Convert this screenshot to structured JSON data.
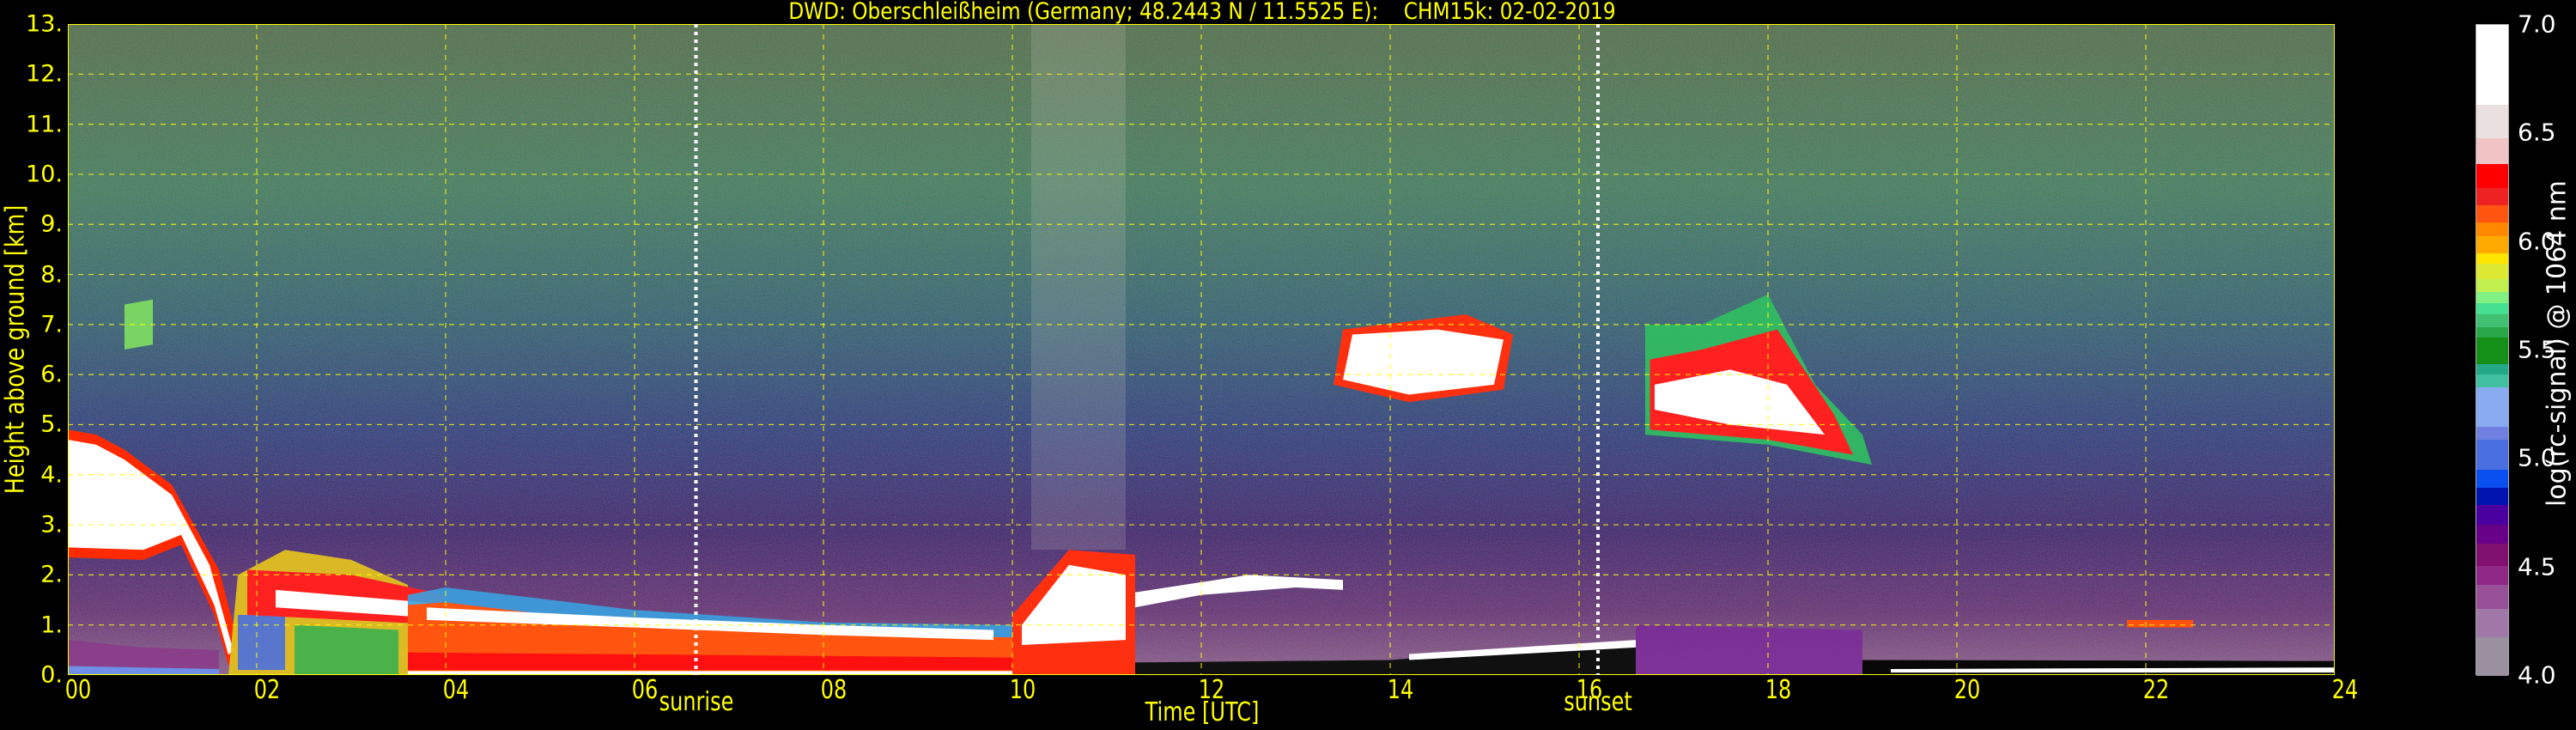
{
  "chart_data": {
    "type": "heatmap",
    "title": "DWD: Oberschleißheim (Germany; 48.2443 N / 11.5525 E):    CHM15k: 02-02-2019",
    "xlabel": "Time [UTC]",
    "ylabel": "Height above ground [km]",
    "xlim": [
      0,
      24
    ],
    "ylim": [
      0,
      13
    ],
    "grid": true,
    "x_ticks": [
      0,
      2,
      4,
      6,
      8,
      10,
      12,
      14,
      16,
      18,
      20,
      22,
      24
    ],
    "x_tick_labels": [
      "00",
      "02",
      "04",
      "06",
      "08",
      "10",
      "12",
      "14",
      "16",
      "18",
      "20",
      "22",
      "24"
    ],
    "y_ticks": [
      0,
      1,
      2,
      3,
      4,
      5,
      6,
      7,
      8,
      9,
      10,
      11,
      12,
      13
    ],
    "y_tick_labels": [
      "0.",
      "1.",
      "2.",
      "3.",
      "4.",
      "5.",
      "6.",
      "7.",
      "8.",
      "9.",
      "10.",
      "11.",
      "12.",
      "13."
    ],
    "markers": [
      {
        "label": "sunrise",
        "x": 6.65
      },
      {
        "label": "sunset",
        "x": 16.2
      }
    ],
    "colorbar": {
      "label": "log(rc-signal) @ 1064 nm",
      "range": [
        4.0,
        7.0
      ],
      "tick_values": [
        4.0,
        4.5,
        5.0,
        5.5,
        6.0,
        6.5,
        7.0
      ],
      "tick_labels": [
        "4.0",
        "4.5",
        "5.0",
        "5.5",
        "6.0",
        "6.5",
        "7.0"
      ],
      "levels": [
        {
          "from": 4.0,
          "to": 4.18,
          "color": "#9a90a0"
        },
        {
          "from": 4.18,
          "to": 4.31,
          "color": "#a078a8"
        },
        {
          "from": 4.31,
          "to": 4.42,
          "color": "#985098"
        },
        {
          "from": 4.42,
          "to": 4.51,
          "color": "#902888"
        },
        {
          "from": 4.51,
          "to": 4.61,
          "color": "#801070"
        },
        {
          "from": 4.61,
          "to": 4.7,
          "color": "#680088"
        },
        {
          "from": 4.7,
          "to": 4.79,
          "color": "#4a00a0"
        },
        {
          "from": 4.79,
          "to": 4.87,
          "color": "#0014b0"
        },
        {
          "from": 4.87,
          "to": 4.95,
          "color": "#0a50f0"
        },
        {
          "from": 4.95,
          "to": 5.09,
          "color": "#4a6fe0"
        },
        {
          "from": 5.09,
          "to": 5.15,
          "color": "#7080e0"
        },
        {
          "from": 5.15,
          "to": 5.33,
          "color": "#88aaf0"
        },
        {
          "from": 5.33,
          "to": 5.39,
          "color": "#40c0a0"
        },
        {
          "from": 5.39,
          "to": 5.44,
          "color": "#24a888"
        },
        {
          "from": 5.44,
          "to": 5.56,
          "color": "#149018"
        },
        {
          "from": 5.56,
          "to": 5.61,
          "color": "#28a848"
        },
        {
          "from": 5.61,
          "to": 5.67,
          "color": "#40c070"
        },
        {
          "from": 5.67,
          "to": 5.72,
          "color": "#44e090"
        },
        {
          "from": 5.72,
          "to": 5.77,
          "color": "#80f080"
        },
        {
          "from": 5.77,
          "to": 5.83,
          "color": "#c0f050"
        },
        {
          "from": 5.83,
          "to": 5.9,
          "color": "#dde833"
        },
        {
          "from": 5.9,
          "to": 5.95,
          "color": "#ffe400"
        },
        {
          "from": 5.95,
          "to": 6.03,
          "color": "#ffaa00"
        },
        {
          "from": 6.03,
          "to": 6.09,
          "color": "#ff8800"
        },
        {
          "from": 6.09,
          "to": 6.17,
          "color": "#ff5511"
        },
        {
          "from": 6.17,
          "to": 6.25,
          "color": "#ee2222"
        },
        {
          "from": 6.25,
          "to": 6.36,
          "color": "#ff0000"
        },
        {
          "from": 6.36,
          "to": 6.48,
          "color": "#f0c4c4"
        },
        {
          "from": 6.48,
          "to": 6.635,
          "color": "#ebe0e0"
        },
        {
          "from": 6.635,
          "to": 7.0,
          "color": "#ffffff"
        }
      ]
    },
    "features": [
      {
        "name": "daytime-column",
        "color": "#d8d0c8",
        "opacity": 0.18,
        "points": [
          [
            10.2,
            2.5
          ],
          [
            11.2,
            2.5
          ],
          [
            11.2,
            13
          ],
          [
            10.2,
            13
          ]
        ]
      },
      {
        "name": "night-surface-layer",
        "color": "#8a3a8a",
        "opacity": 0.85,
        "points": [
          [
            0,
            0
          ],
          [
            1.6,
            0
          ],
          [
            1.6,
            0.5
          ],
          [
            0.8,
            0.55
          ],
          [
            0,
            0.7
          ]
        ]
      },
      {
        "name": "surface-blue",
        "color": "#6f8fe8",
        "opacity": 1,
        "points": [
          [
            0,
            0
          ],
          [
            1.6,
            0
          ],
          [
            1.6,
            0.12
          ],
          [
            0,
            0.18
          ]
        ]
      },
      {
        "name": "residual-layer-edge",
        "color": "#ff2a00",
        "opacity": 1,
        "points": [
          [
            0,
            2.35
          ],
          [
            0.8,
            2.3
          ],
          [
            1.2,
            2.6
          ],
          [
            1.55,
            1.2
          ],
          [
            1.7,
            0.2
          ],
          [
            1.85,
            0.3
          ],
          [
            1.6,
            2.1
          ],
          [
            1.1,
            3.8
          ],
          [
            0.6,
            4.5
          ],
          [
            0.3,
            4.8
          ],
          [
            0,
            4.9
          ]
        ]
      },
      {
        "name": "residual-layer",
        "color": "#ffffff",
        "opacity": 1,
        "points": [
          [
            0,
            2.55
          ],
          [
            0.8,
            2.5
          ],
          [
            1.2,
            2.8
          ],
          [
            1.55,
            1.4
          ],
          [
            1.7,
            0.4
          ],
          [
            1.75,
            0.5
          ],
          [
            1.5,
            2.2
          ],
          [
            1.1,
            3.6
          ],
          [
            0.6,
            4.3
          ],
          [
            0.3,
            4.6
          ],
          [
            0,
            4.7
          ]
        ]
      },
      {
        "name": "elevated-plume",
        "color": "#80e060",
        "opacity": 0.9,
        "points": [
          [
            0.6,
            6.5
          ],
          [
            0.9,
            6.6
          ],
          [
            0.9,
            7.5
          ],
          [
            0.6,
            7.4
          ]
        ]
      },
      {
        "name": "morning-mixed-layer",
        "color": "#e0c020",
        "opacity": 0.95,
        "points": [
          [
            1.7,
            0
          ],
          [
            3.6,
            0
          ],
          [
            3.6,
            1.8
          ],
          [
            3.0,
            2.3
          ],
          [
            2.3,
            2.5
          ],
          [
            1.8,
            2.0
          ]
        ]
      },
      {
        "name": "morning-mixed-green",
        "color": "#30b050",
        "opacity": 0.85,
        "points": [
          [
            2.4,
            0
          ],
          [
            3.5,
            0
          ],
          [
            3.5,
            0.9
          ],
          [
            2.4,
            1.0
          ]
        ]
      },
      {
        "name": "morning-blue-patch",
        "color": "#4a6fe0",
        "opacity": 0.9,
        "points": [
          [
            1.8,
            0.1
          ],
          [
            2.3,
            0.1
          ],
          [
            2.3,
            1.2
          ],
          [
            1.8,
            1.2
          ]
        ]
      },
      {
        "name": "morning-red-band",
        "color": "#ff2020",
        "opacity": 1,
        "points": [
          [
            1.9,
            1.2
          ],
          [
            4.0,
            1.0
          ],
          [
            4.0,
            1.6
          ],
          [
            3.0,
            2.0
          ],
          [
            1.9,
            2.1
          ]
        ]
      },
      {
        "name": "morning-white-band",
        "color": "#ffffff",
        "opacity": 1,
        "points": [
          [
            2.2,
            1.35
          ],
          [
            3.8,
            1.15
          ],
          [
            3.8,
            1.45
          ],
          [
            2.2,
            1.7
          ]
        ]
      },
      {
        "name": "day-boundary-layer-edge",
        "color": "#3aa0e0",
        "opacity": 0.9,
        "points": [
          [
            3.6,
            0
          ],
          [
            10,
            0
          ],
          [
            10,
            1.0
          ],
          [
            8,
            1.05
          ],
          [
            6,
            1.3
          ],
          [
            4,
            1.75
          ],
          [
            3.6,
            1.6
          ]
        ]
      },
      {
        "name": "day-boundary-layer",
        "color": "#ff5510",
        "opacity": 1,
        "points": [
          [
            3.6,
            0
          ],
          [
            10,
            0
          ],
          [
            10,
            0.75
          ],
          [
            8,
            0.85
          ],
          [
            6,
            1.0
          ],
          [
            4,
            1.45
          ],
          [
            3.6,
            1.4
          ]
        ]
      },
      {
        "name": "day-boundary-layer-red",
        "color": "#ff1010",
        "opacity": 1,
        "points": [
          [
            3.6,
            0.1
          ],
          [
            10,
            0.1
          ],
          [
            10,
            0.35
          ],
          [
            3.6,
            0.45
          ]
        ]
      },
      {
        "name": "day-boundary-layer-top",
        "color": "#ffffff",
        "opacity": 1,
        "points": [
          [
            3.8,
            1.1
          ],
          [
            6,
            0.95
          ],
          [
            8,
            0.8
          ],
          [
            9.8,
            0.7
          ],
          [
            9.8,
            0.9
          ],
          [
            8,
            1.0
          ],
          [
            6,
            1.15
          ],
          [
            3.8,
            1.35
          ]
        ]
      },
      {
        "name": "day-surface-white",
        "color": "#ffffff",
        "opacity": 1,
        "points": [
          [
            3.6,
            0
          ],
          [
            10,
            0
          ],
          [
            10,
            0.08
          ],
          [
            3.6,
            0.08
          ]
        ]
      },
      {
        "name": "midday-mixed",
        "color": "#ff3010",
        "opacity": 1,
        "points": [
          [
            10,
            0
          ],
          [
            11.3,
            0
          ],
          [
            11.3,
            2.4
          ],
          [
            10.6,
            2.5
          ],
          [
            10,
            1.2
          ]
        ]
      },
      {
        "name": "midday-mixed-white",
        "color": "#ffffff",
        "opacity": 1,
        "points": [
          [
            10.1,
            0.6
          ],
          [
            11.2,
            0.7
          ],
          [
            11.2,
            2.0
          ],
          [
            10.6,
            2.2
          ],
          [
            10.1,
            1.0
          ]
        ]
      },
      {
        "name": "afternoon-layer-top",
        "color": "#ffffff",
        "opacity": 1,
        "points": [
          [
            11.3,
            1.35
          ],
          [
            12,
            1.6
          ],
          [
            13,
            1.75
          ],
          [
            13.5,
            1.7
          ],
          [
            13.5,
            1.9
          ],
          [
            12.5,
            2.0
          ],
          [
            11.3,
            1.65
          ]
        ]
      },
      {
        "name": "afternoon-surface",
        "color": "#101010",
        "opacity": 1,
        "points": [
          [
            11.3,
            0
          ],
          [
            16.6,
            0
          ],
          [
            16.6,
            0.7
          ],
          [
            14,
            0.3
          ],
          [
            11.3,
            0.25
          ]
        ]
      },
      {
        "name": "afternoon-surface-top",
        "color": "#ffffff",
        "opacity": 1,
        "points": [
          [
            14.2,
            0.3
          ],
          [
            16.6,
            0.55
          ],
          [
            16.6,
            0.7
          ],
          [
            14.2,
            0.42
          ]
        ]
      },
      {
        "name": "mid-cloud-edge",
        "color": "#ff3010",
        "opacity": 1,
        "points": [
          [
            13.4,
            5.8
          ],
          [
            14.2,
            5.45
          ],
          [
            15.2,
            5.7
          ],
          [
            15.3,
            6.8
          ],
          [
            14.8,
            7.2
          ],
          [
            13.5,
            6.9
          ]
        ]
      },
      {
        "name": "mid-cloud",
        "color": "#ffffff",
        "opacity": 1,
        "points": [
          [
            13.5,
            5.9
          ],
          [
            14.2,
            5.6
          ],
          [
            15.1,
            5.8
          ],
          [
            15.2,
            6.7
          ],
          [
            14.5,
            6.9
          ],
          [
            13.6,
            6.8
          ]
        ]
      },
      {
        "name": "evening-cloud-edge",
        "color": "#30c060",
        "opacity": 0.9,
        "points": [
          [
            16.7,
            4.8
          ],
          [
            18,
            4.6
          ],
          [
            19.1,
            4.2
          ],
          [
            19.0,
            4.8
          ],
          [
            18.5,
            5.8
          ],
          [
            18,
            7.6
          ],
          [
            17.3,
            7.0
          ],
          [
            16.7,
            7.0
          ]
        ]
      },
      {
        "name": "evening-cloud-red",
        "color": "#ff2020",
        "opacity": 1,
        "points": [
          [
            16.75,
            4.9
          ],
          [
            18,
            4.7
          ],
          [
            18.9,
            4.4
          ],
          [
            18.7,
            5.2
          ],
          [
            18.1,
            6.9
          ],
          [
            17.3,
            6.5
          ],
          [
            16.75,
            6.3
          ]
        ]
      },
      {
        "name": "evening-cloud",
        "color": "#ffffff",
        "opacity": 1,
        "points": [
          [
            16.8,
            5.3
          ],
          [
            17.6,
            5.0
          ],
          [
            18.6,
            4.8
          ],
          [
            18.2,
            5.8
          ],
          [
            17.6,
            6.1
          ],
          [
            16.8,
            5.8
          ]
        ]
      },
      {
        "name": "evening-surface-purple",
        "color": "#7a2a9a",
        "opacity": 0.85,
        "points": [
          [
            16.6,
            0
          ],
          [
            19,
            0
          ],
          [
            19,
            0.9
          ],
          [
            16.6,
            1.0
          ]
        ]
      },
      {
        "name": "night-surface-black",
        "color": "#080808",
        "opacity": 1,
        "points": [
          [
            19,
            0
          ],
          [
            24,
            0
          ],
          [
            24,
            0.28
          ],
          [
            19,
            0.3
          ]
        ]
      },
      {
        "name": "night-surface-white",
        "color": "#ffffff",
        "opacity": 1,
        "points": [
          [
            19.3,
            0.05
          ],
          [
            24,
            0.05
          ],
          [
            24,
            0.15
          ],
          [
            19.3,
            0.12
          ]
        ]
      },
      {
        "name": "night-plume",
        "color": "#ff5010",
        "opacity": 1,
        "points": [
          [
            21.8,
            0.95
          ],
          [
            22.5,
            0.95
          ],
          [
            22.5,
            1.1
          ],
          [
            21.8,
            1.1
          ]
        ]
      }
    ]
  }
}
